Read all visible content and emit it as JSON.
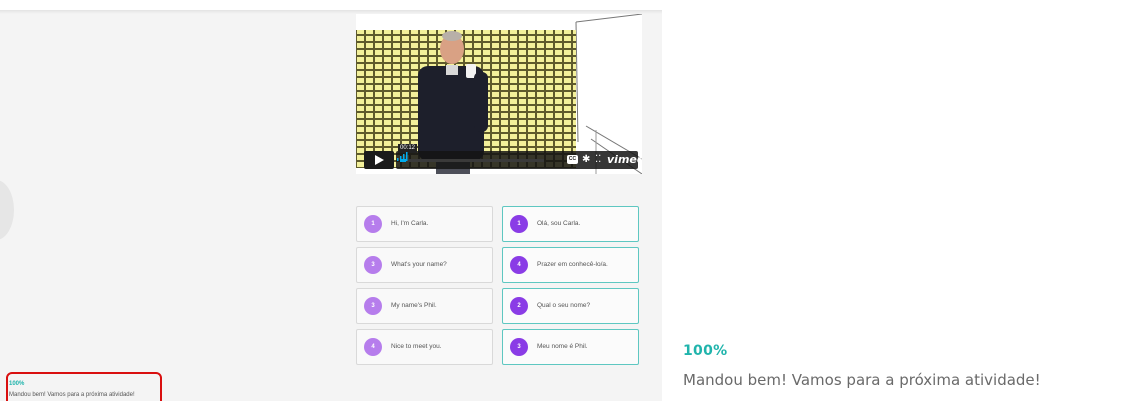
{
  "video": {
    "time": "00:12",
    "progress": 0.04,
    "cc_label": "CC",
    "provider": "vimeo"
  },
  "matching": {
    "left": [
      {
        "num": "1",
        "text": "Hi, I'm Carla."
      },
      {
        "num": "3",
        "text": "What's your name?"
      },
      {
        "num": "3",
        "text": "My name's Phil."
      },
      {
        "num": "4",
        "text": "Nice to meet you."
      }
    ],
    "right": [
      {
        "num": "1",
        "text": "Olá, sou Carla."
      },
      {
        "num": "4",
        "text": "Prazer em conhecê-lo/a."
      },
      {
        "num": "2",
        "text": "Qual o seu nome?"
      },
      {
        "num": "3",
        "text": "Meu nome é Phil."
      }
    ]
  },
  "feedback": {
    "percent": "100%",
    "message": "Mandou bem! Vamos para a próxima atividade!"
  },
  "colors": {
    "teal": "#20b4ac",
    "purple_light": "#b67dec",
    "purple_dark": "#8a3ce6",
    "highlight_red": "#d90f0f"
  }
}
